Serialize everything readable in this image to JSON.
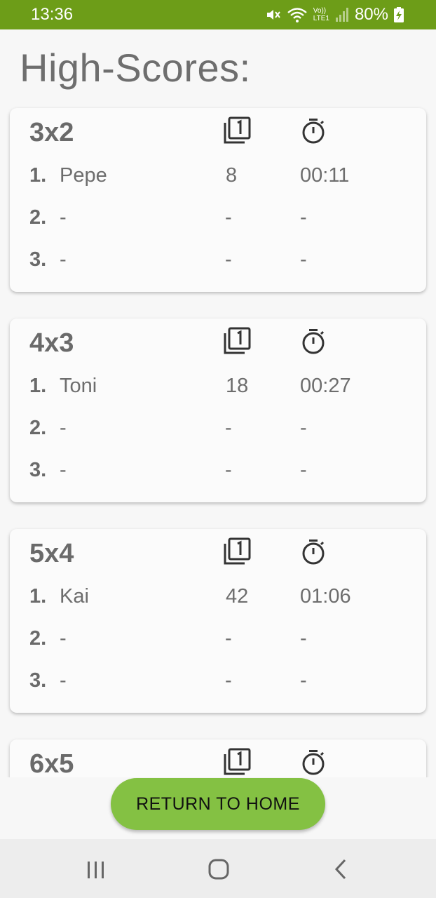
{
  "status_bar": {
    "time": "13:36",
    "battery": "80%",
    "icons": [
      "mute-icon",
      "wifi-icon",
      "volte-lte-icon",
      "signal-icon",
      "battery-charging-icon"
    ],
    "volte_label": "Vo))",
    "lte_label": "LTE1"
  },
  "page": {
    "title": "High-Scores:"
  },
  "cards": [
    {
      "title": "3x2",
      "rows": [
        {
          "rank": "1.",
          "name": "Pepe",
          "moves": "8",
          "time": "00:11"
        },
        {
          "rank": "2.",
          "name": "-",
          "moves": "-",
          "time": "-"
        },
        {
          "rank": "3.",
          "name": "-",
          "moves": "-",
          "time": "-"
        }
      ]
    },
    {
      "title": "4x3",
      "rows": [
        {
          "rank": "1.",
          "name": "Toni",
          "moves": "18",
          "time": "00:27"
        },
        {
          "rank": "2.",
          "name": "-",
          "moves": "-",
          "time": "-"
        },
        {
          "rank": "3.",
          "name": "-",
          "moves": "-",
          "time": "-"
        }
      ]
    },
    {
      "title": "5x4",
      "rows": [
        {
          "rank": "1.",
          "name": "Kai",
          "moves": "42",
          "time": "01:06"
        },
        {
          "rank": "2.",
          "name": "-",
          "moves": "-",
          "time": "-"
        },
        {
          "rank": "3.",
          "name": "-",
          "moves": "-",
          "time": "-"
        }
      ]
    },
    {
      "title": "6x5",
      "rows": []
    }
  ],
  "column_icons": {
    "moves": "filter-1-icon",
    "time": "stopwatch-icon"
  },
  "actions": {
    "return_home": "RETURN TO HOME"
  },
  "nav_bar": {
    "items": [
      "recent-apps-icon",
      "home-icon",
      "back-icon"
    ]
  },
  "colors": {
    "status_bar": "#6d9d18",
    "button": "#84c143",
    "text": "#6d6d6d",
    "background": "#f7f7f7"
  }
}
